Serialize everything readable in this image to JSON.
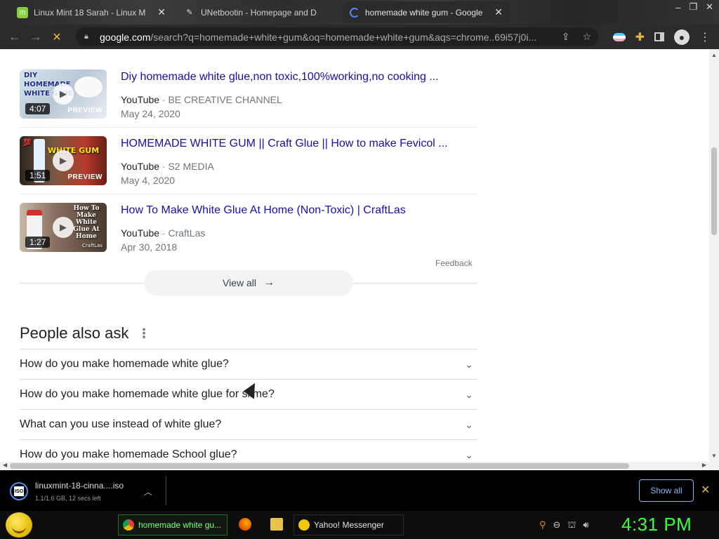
{
  "browser": {
    "tabs": [
      {
        "label": "Linux Mint 18 Sarah - Linux M",
        "icon": "linux-mint-icon",
        "active": false
      },
      {
        "label": "UNetbootin - Homepage and D",
        "icon": "unetbootin-icon",
        "active": false
      },
      {
        "label": "homemade white gum - Google",
        "icon": "loading-spinner-icon",
        "active": true
      }
    ],
    "url_host": "google.com",
    "url_rest": "/search?q=homemade+white+gum&oq=homemade+white+gum&aqs=chrome..69i57j0i..."
  },
  "videos": [
    {
      "title": "Diy homemade white glue,non toxic,100%working,no cooking ...",
      "source": "YouTube",
      "channel": "BE CREATIVE CHANNEL",
      "date": "May 24, 2020",
      "duration": "4:07",
      "preview": "PREVIEW",
      "thumb_caption": "DIY HOMEMADE WHITE GLUE"
    },
    {
      "title": "HOMEMADE WHITE GUM || Craft Glue || How to make Fevicol ...",
      "source": "YouTube",
      "channel": "S2 MEDIA",
      "date": "May 4, 2020",
      "duration": "1:51",
      "preview": "PREVIEW",
      "thumb_caption": "WHITE GUM"
    },
    {
      "title": "How To Make White Glue At Home (Non-Toxic) | CraftLas",
      "source": "YouTube",
      "channel": "CraftLas",
      "date": "Apr 30, 2018",
      "duration": "1:27",
      "preview": "",
      "thumb_caption": "How To Make White Glue At Home",
      "thumb_brand": "CraftLas"
    }
  ],
  "feedback_label": "Feedback",
  "view_all_label": "View all",
  "people_also_ask": {
    "title": "People also ask",
    "questions": [
      "How do you make homemade white glue?",
      "How do you make homemade white glue for slime?",
      "What can you use instead of white glue?",
      "How do you make homemade School glue?"
    ]
  },
  "download": {
    "filename": "linuxmint-18-cinna....iso",
    "status": "1.1/1.6 GB, 12 secs left",
    "icon_text": "ISO",
    "show_all_label": "Show all"
  },
  "taskbar": {
    "chrome_task_label": "homemade white gu...",
    "yahoo_task_label": "Yahoo! Messenger",
    "clock": "4:31 PM"
  },
  "colors": {
    "link": "#1a0dab",
    "accent_blue": "#8ab4f8",
    "clock_green": "#39ff39"
  }
}
